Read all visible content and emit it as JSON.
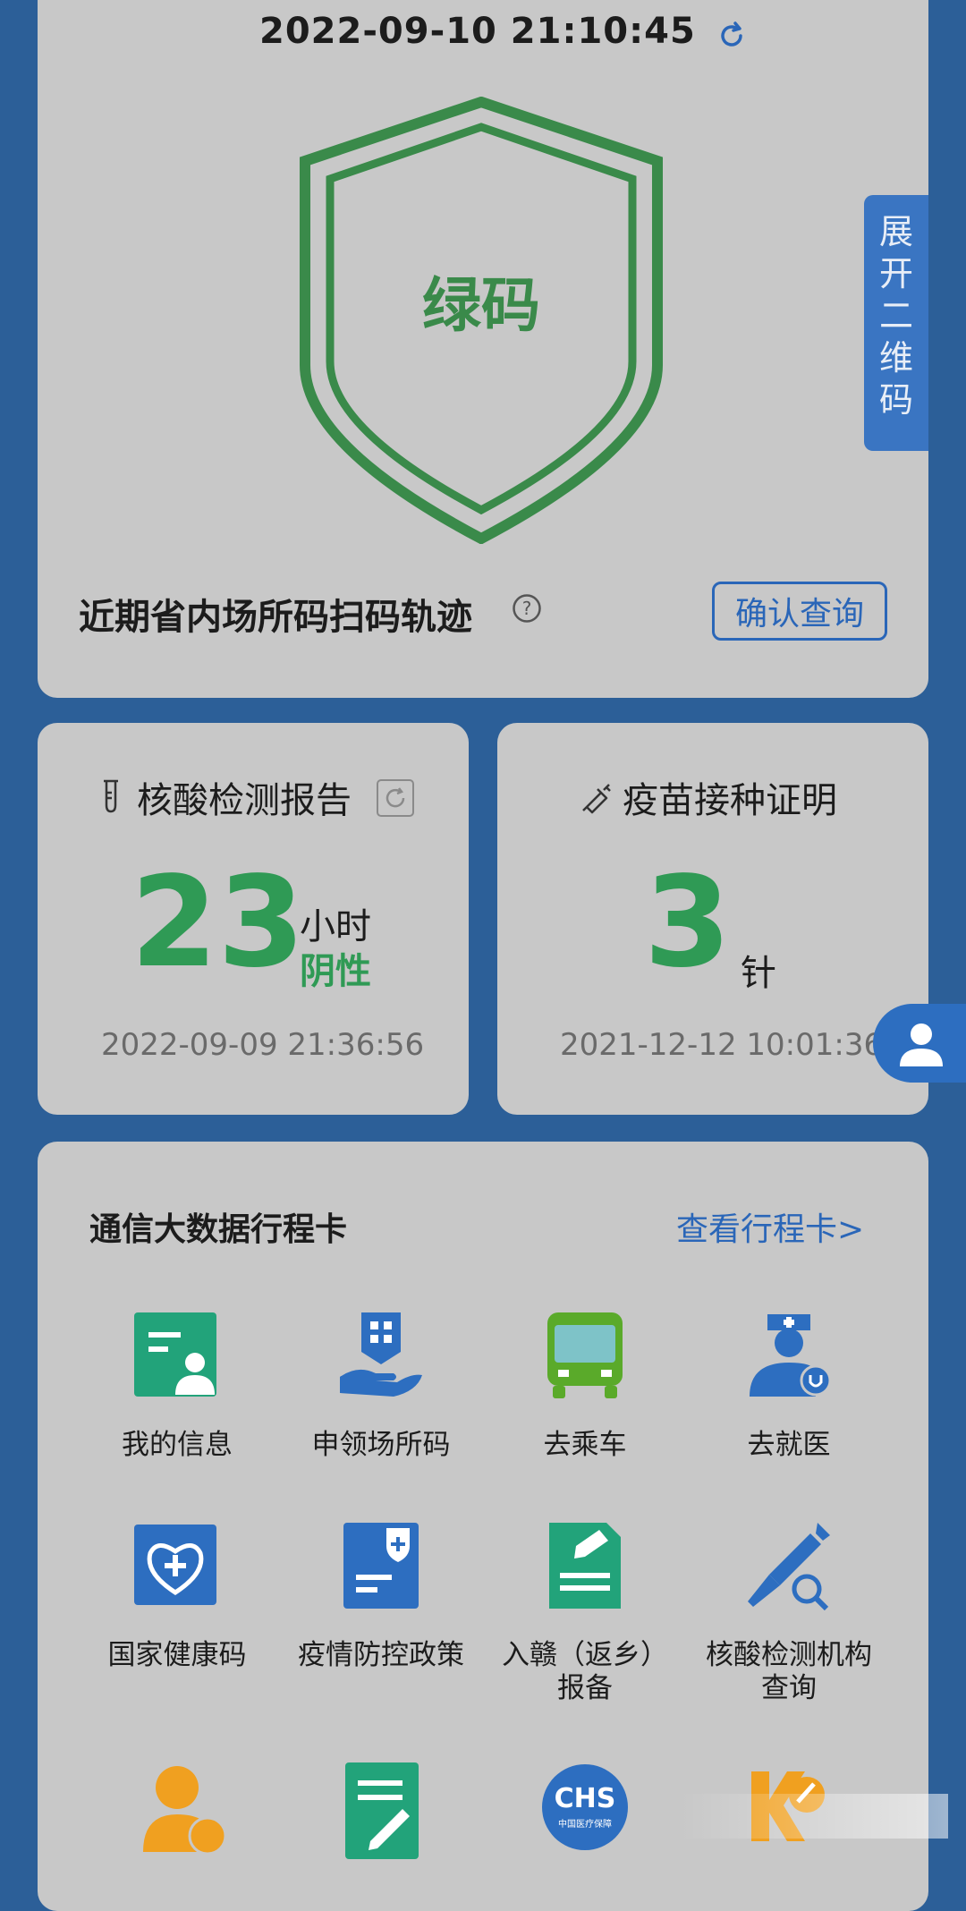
{
  "header": {
    "timestamp": "2022-09-10 21:10:45"
  },
  "health_code": {
    "status_label": "绿码",
    "color": "#3a8a4a"
  },
  "expand_tab": {
    "label_chars": [
      "展",
      "开",
      "二",
      "维",
      "码"
    ]
  },
  "track": {
    "label": "近期省内场所码扫码轨迹",
    "button": "确认查询"
  },
  "nucleic": {
    "title": "核酸检测报告",
    "hours": "23",
    "unit": "小时",
    "result": "阴性",
    "date": "2022-09-09 21:36:56"
  },
  "vaccine": {
    "title": "疫苗接种证明",
    "doses": "3",
    "unit": "针",
    "date": "2021-12-12 10:01:36"
  },
  "itinerary": {
    "label": "通信大数据行程卡",
    "link": "查看行程卡>"
  },
  "tiles": [
    {
      "label": "我的信息",
      "icon": "id-card-icon"
    },
    {
      "label": "申领场所码",
      "icon": "qr-hand-icon"
    },
    {
      "label": "去乘车",
      "icon": "bus-icon"
    },
    {
      "label": "去就医",
      "icon": "doctor-icon"
    },
    {
      "label": "国家健康码",
      "icon": "heart-plus-icon"
    },
    {
      "label": "疫情防控政策",
      "icon": "policy-document-icon"
    },
    {
      "label": "入赣（返乡）\n报备",
      "icon": "report-document-icon"
    },
    {
      "label": "核酸检测机构\n查询",
      "icon": "syringe-search-icon"
    }
  ],
  "bottom_icons": {
    "chs_text": "CHS",
    "chs_sub": "中国医疗保障"
  }
}
